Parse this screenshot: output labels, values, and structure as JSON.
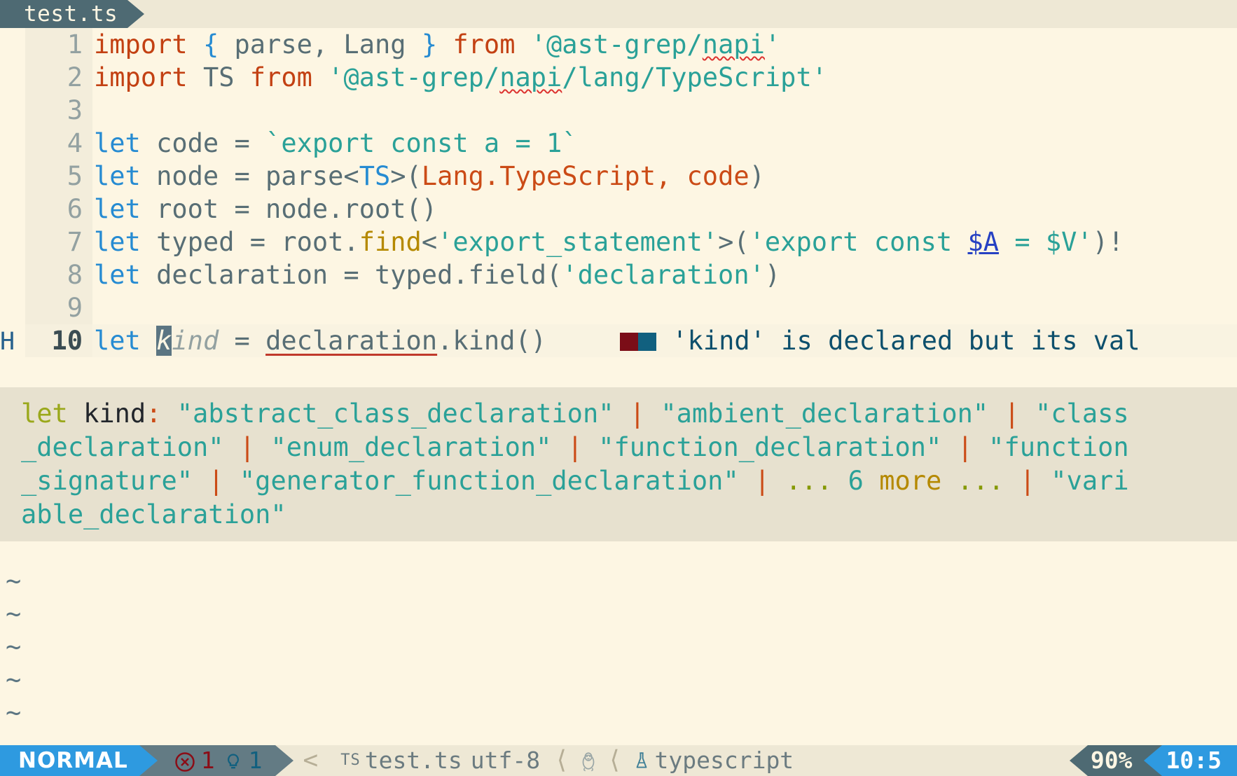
{
  "tabline": {
    "tabs": [
      {
        "label": "test.ts",
        "active": true
      }
    ]
  },
  "editor": {
    "filetype": "typescript",
    "lines": [
      {
        "num": "1",
        "sign": "",
        "tokens": [
          {
            "t": "import",
            "c": "kw"
          },
          {
            "t": " ",
            "c": "op"
          },
          {
            "t": "{",
            "c": "punct"
          },
          {
            "t": " parse, Lang ",
            "c": "ident"
          },
          {
            "t": "}",
            "c": "punct"
          },
          {
            "t": " ",
            "c": "op"
          },
          {
            "t": "from",
            "c": "kw"
          },
          {
            "t": " '@ast-grep/",
            "c": "str"
          },
          {
            "t": "napi",
            "c": "str spellerr"
          },
          {
            "t": "'",
            "c": "str"
          }
        ]
      },
      {
        "num": "2",
        "sign": "",
        "tokens": [
          {
            "t": "import",
            "c": "kw"
          },
          {
            "t": " ",
            "c": "op"
          },
          {
            "t": "TS",
            "c": "ident"
          },
          {
            "t": " ",
            "c": "op"
          },
          {
            "t": "from",
            "c": "kw"
          },
          {
            "t": " '@ast-grep/",
            "c": "str"
          },
          {
            "t": "napi",
            "c": "str spellerr"
          },
          {
            "t": "/lang/TypeScript'",
            "c": "str"
          }
        ]
      },
      {
        "num": "3",
        "sign": "",
        "tokens": []
      },
      {
        "num": "4",
        "sign": "",
        "tokens": [
          {
            "t": "let",
            "c": "kw2"
          },
          {
            "t": " code ",
            "c": "ident"
          },
          {
            "t": "=",
            "c": "op"
          },
          {
            "t": " ",
            "c": "op"
          },
          {
            "t": "`export const a = 1`",
            "c": "str"
          }
        ]
      },
      {
        "num": "5",
        "sign": "",
        "tokens": [
          {
            "t": "let",
            "c": "kw2"
          },
          {
            "t": " node ",
            "c": "ident"
          },
          {
            "t": "=",
            "c": "op"
          },
          {
            "t": " parse",
            "c": "ident"
          },
          {
            "t": "<",
            "c": "op"
          },
          {
            "t": "TS",
            "c": "type"
          },
          {
            "t": ">(",
            "c": "op"
          },
          {
            "t": "Lang.TypeScript",
            "c": "param"
          },
          {
            "t": ", ",
            "c": "param"
          },
          {
            "t": "code",
            "c": "param"
          },
          {
            "t": ")",
            "c": "op"
          }
        ]
      },
      {
        "num": "6",
        "sign": "",
        "tokens": [
          {
            "t": "let",
            "c": "kw2"
          },
          {
            "t": " root ",
            "c": "ident"
          },
          {
            "t": "=",
            "c": "op"
          },
          {
            "t": " node.root()",
            "c": "ident"
          }
        ]
      },
      {
        "num": "7",
        "sign": "",
        "tokens": [
          {
            "t": "let",
            "c": "kw2"
          },
          {
            "t": " typed ",
            "c": "ident"
          },
          {
            "t": "=",
            "c": "op"
          },
          {
            "t": " root.",
            "c": "ident"
          },
          {
            "t": "find",
            "c": "func"
          },
          {
            "t": "<",
            "c": "op"
          },
          {
            "t": "'export_statement'",
            "c": "str"
          },
          {
            "t": ">(",
            "c": "op"
          },
          {
            "t": "'export const ",
            "c": "str"
          },
          {
            "t": "$A",
            "c": "metavar"
          },
          {
            "t": " = $V'",
            "c": "str"
          },
          {
            "t": ")!",
            "c": "op"
          }
        ]
      },
      {
        "num": "8",
        "sign": "",
        "tokens": [
          {
            "t": "let",
            "c": "kw2"
          },
          {
            "t": " declaration ",
            "c": "ident"
          },
          {
            "t": "=",
            "c": "op"
          },
          {
            "t": " typed.field(",
            "c": "ident"
          },
          {
            "t": "'declaration'",
            "c": "str"
          },
          {
            "t": ")",
            "c": "ident"
          }
        ]
      },
      {
        "num": "9",
        "sign": "",
        "tokens": []
      },
      {
        "num": "10",
        "sign": "H",
        "cursorline": true,
        "tokens": [
          {
            "t": "let",
            "c": "kw2"
          },
          {
            "t": " ",
            "c": "op"
          },
          {
            "t": "k",
            "c": "cursor"
          },
          {
            "t": "ind",
            "c": "unused"
          },
          {
            "t": " ",
            "c": "op"
          },
          {
            "t": "=",
            "c": "op"
          },
          {
            "t": " ",
            "c": "op"
          },
          {
            "t": "declaration",
            "c": "ident errunder"
          },
          {
            "t": ".kind()",
            "c": "ident"
          }
        ],
        "diagnostic": "'kind' is declared but its val"
      }
    ],
    "fillers": [
      "~",
      "~",
      "~",
      "~",
      "~"
    ]
  },
  "hover": {
    "lines": [
      [
        {
          "t": "let",
          "c": "h-let"
        },
        {
          "t": " ",
          "c": "h-name"
        },
        {
          "t": "kind",
          "c": "h-name"
        },
        {
          "t": ":",
          "c": "h-colon"
        },
        {
          "t": " ",
          "c": "h-name"
        },
        {
          "t": "\"abstract_class_declaration\"",
          "c": "h-str"
        },
        {
          "t": " ",
          "c": "h-name"
        },
        {
          "t": "|",
          "c": "h-pipe"
        },
        {
          "t": " ",
          "c": "h-name"
        },
        {
          "t": "\"ambient_declaration\"",
          "c": "h-str"
        },
        {
          "t": " ",
          "c": "h-name"
        },
        {
          "t": "|",
          "c": "h-pipe"
        },
        {
          "t": " ",
          "c": "h-name"
        },
        {
          "t": "\"class",
          "c": "h-str"
        }
      ],
      [
        {
          "t": "_declaration\"",
          "c": "h-str"
        },
        {
          "t": " ",
          "c": "h-name"
        },
        {
          "t": "|",
          "c": "h-pipe"
        },
        {
          "t": " ",
          "c": "h-name"
        },
        {
          "t": "\"enum_declaration\"",
          "c": "h-str"
        },
        {
          "t": " ",
          "c": "h-name"
        },
        {
          "t": "|",
          "c": "h-pipe"
        },
        {
          "t": " ",
          "c": "h-name"
        },
        {
          "t": "\"function_declaration\"",
          "c": "h-str"
        },
        {
          "t": " ",
          "c": "h-name"
        },
        {
          "t": "|",
          "c": "h-pipe"
        },
        {
          "t": " ",
          "c": "h-name"
        },
        {
          "t": "\"function",
          "c": "h-str"
        }
      ],
      [
        {
          "t": "_signature\"",
          "c": "h-str"
        },
        {
          "t": " ",
          "c": "h-name"
        },
        {
          "t": "|",
          "c": "h-pipe"
        },
        {
          "t": " ",
          "c": "h-name"
        },
        {
          "t": "\"generator_function_declaration\"",
          "c": "h-str"
        },
        {
          "t": " ",
          "c": "h-name"
        },
        {
          "t": "|",
          "c": "h-pipe"
        },
        {
          "t": " ",
          "c": "h-name"
        },
        {
          "t": "...",
          "c": "h-dots"
        },
        {
          "t": " ",
          "c": "h-name"
        },
        {
          "t": "6",
          "c": "h-num"
        },
        {
          "t": " ",
          "c": "h-name"
        },
        {
          "t": "more",
          "c": "h-more"
        },
        {
          "t": " ",
          "c": "h-name"
        },
        {
          "t": "...",
          "c": "h-dots"
        },
        {
          "t": " ",
          "c": "h-name"
        },
        {
          "t": "|",
          "c": "h-pipe"
        },
        {
          "t": " ",
          "c": "h-name"
        },
        {
          "t": "\"vari",
          "c": "h-str"
        }
      ],
      [
        {
          "t": "able_declaration\"",
          "c": "h-str"
        }
      ]
    ],
    "full_text": "let kind: \"abstract_class_declaration\" | \"ambient_declaration\" | \"class_declaration\" | \"enum_declaration\" | \"function_declaration\" | \"function_signature\" | \"generator_function_declaration\" | ... 6 more ... | \"variable_declaration\""
  },
  "statusline": {
    "mode": "NORMAL",
    "error_count": "1",
    "hint_count": "1",
    "separator": "<",
    "filetype_badge": "TS",
    "filename": "test.ts",
    "encoding": "utf-8",
    "os_icon": "linux-penguin-icon",
    "lsp_icon": "flask-icon",
    "language": "typescript",
    "percent": "90%",
    "position": "10:5"
  },
  "colors": {
    "background": "#fdf6e3",
    "accent_blue": "#2e9ae0",
    "tab_dark": "#4e6a73",
    "status_gray": "#637b84",
    "hover_bg": "#e7e1cf",
    "error_red": "#8b0d17",
    "hint_blue": "#11607f",
    "string_teal": "#2aa198",
    "keyword_orange": "#c34113"
  }
}
